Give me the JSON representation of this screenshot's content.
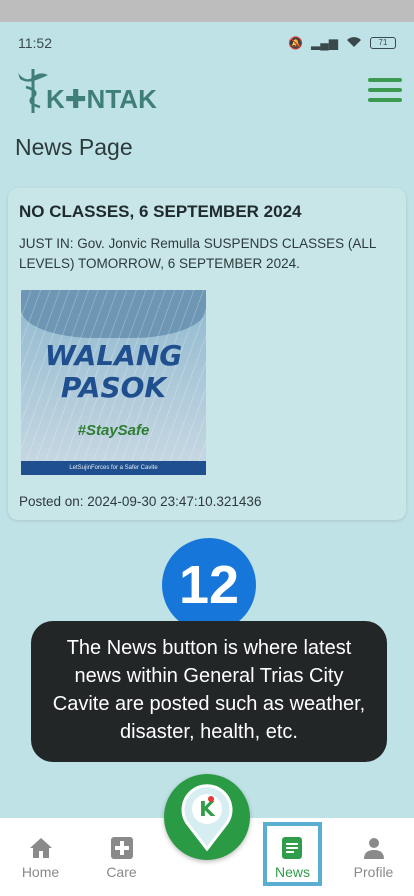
{
  "status_bar": {
    "time": "11:52",
    "battery": "71"
  },
  "header": {
    "logo_text": "K✚NTAK"
  },
  "page": {
    "title": "News Page"
  },
  "news": [
    {
      "title": "NO CLASSES, 6 SEPTEMBER 2024",
      "body": "JUST IN: Gov. Jonvic Remulla SUSPENDS CLASSES (ALL LEVELS) TOMORROW, 6 SEPTEMBER 2024.",
      "image_text": {
        "line1": "WALANG",
        "line2": "PASOK",
        "hashtag": "#StaySafe",
        "footer": "LetSujinForces for a Safer Cavite"
      },
      "posted": "Posted on: 2024-09-30 23:47:10.321436"
    }
  ],
  "tutorial": {
    "step": "12",
    "text": "The News button is where latest news within General Trias City Cavite are posted such as weather, disaster, health, etc."
  },
  "bottom_nav": [
    {
      "label": "Home",
      "icon": "home-icon"
    },
    {
      "label": "Care",
      "icon": "medical-cross-icon"
    },
    {
      "label": "News",
      "icon": "news-document-icon",
      "active": true
    },
    {
      "label": "Profile",
      "icon": "person-icon"
    }
  ],
  "colors": {
    "brand_green": "#2f9d4a",
    "tooltip_bg": "#222627",
    "badge_blue": "#1776d9",
    "highlight": "#5aaed2"
  }
}
